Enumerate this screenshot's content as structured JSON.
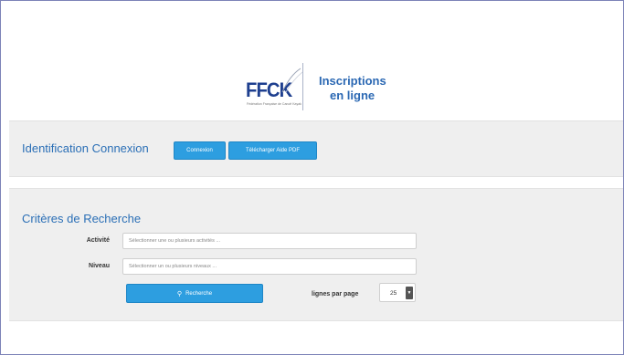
{
  "header": {
    "logo_text": "FFCK",
    "logo_tagline": "Fédération Française de Canoë Kayak",
    "title_line1": "Inscriptions",
    "title_line2": "en ligne"
  },
  "identification": {
    "title": "Identification Connexion",
    "connexion_label": "Connexion",
    "pdf_label": "Télécharger Aide PDF"
  },
  "search": {
    "title": "Critères de Recherche",
    "activite_label": "Activité",
    "activite_placeholder": "Sélectionner une ou plusieurs activités ...",
    "niveau_label": "Niveau",
    "niveau_placeholder": "Sélectionner un ou plusieurs niveaux ...",
    "search_button_label": "Recherche",
    "lignes_label": "lignes par page",
    "lignes_value": "25"
  },
  "colors": {
    "accent": "#2d9ee0",
    "title_blue": "#2b6fb6",
    "logo_blue": "#1e3f8f"
  }
}
